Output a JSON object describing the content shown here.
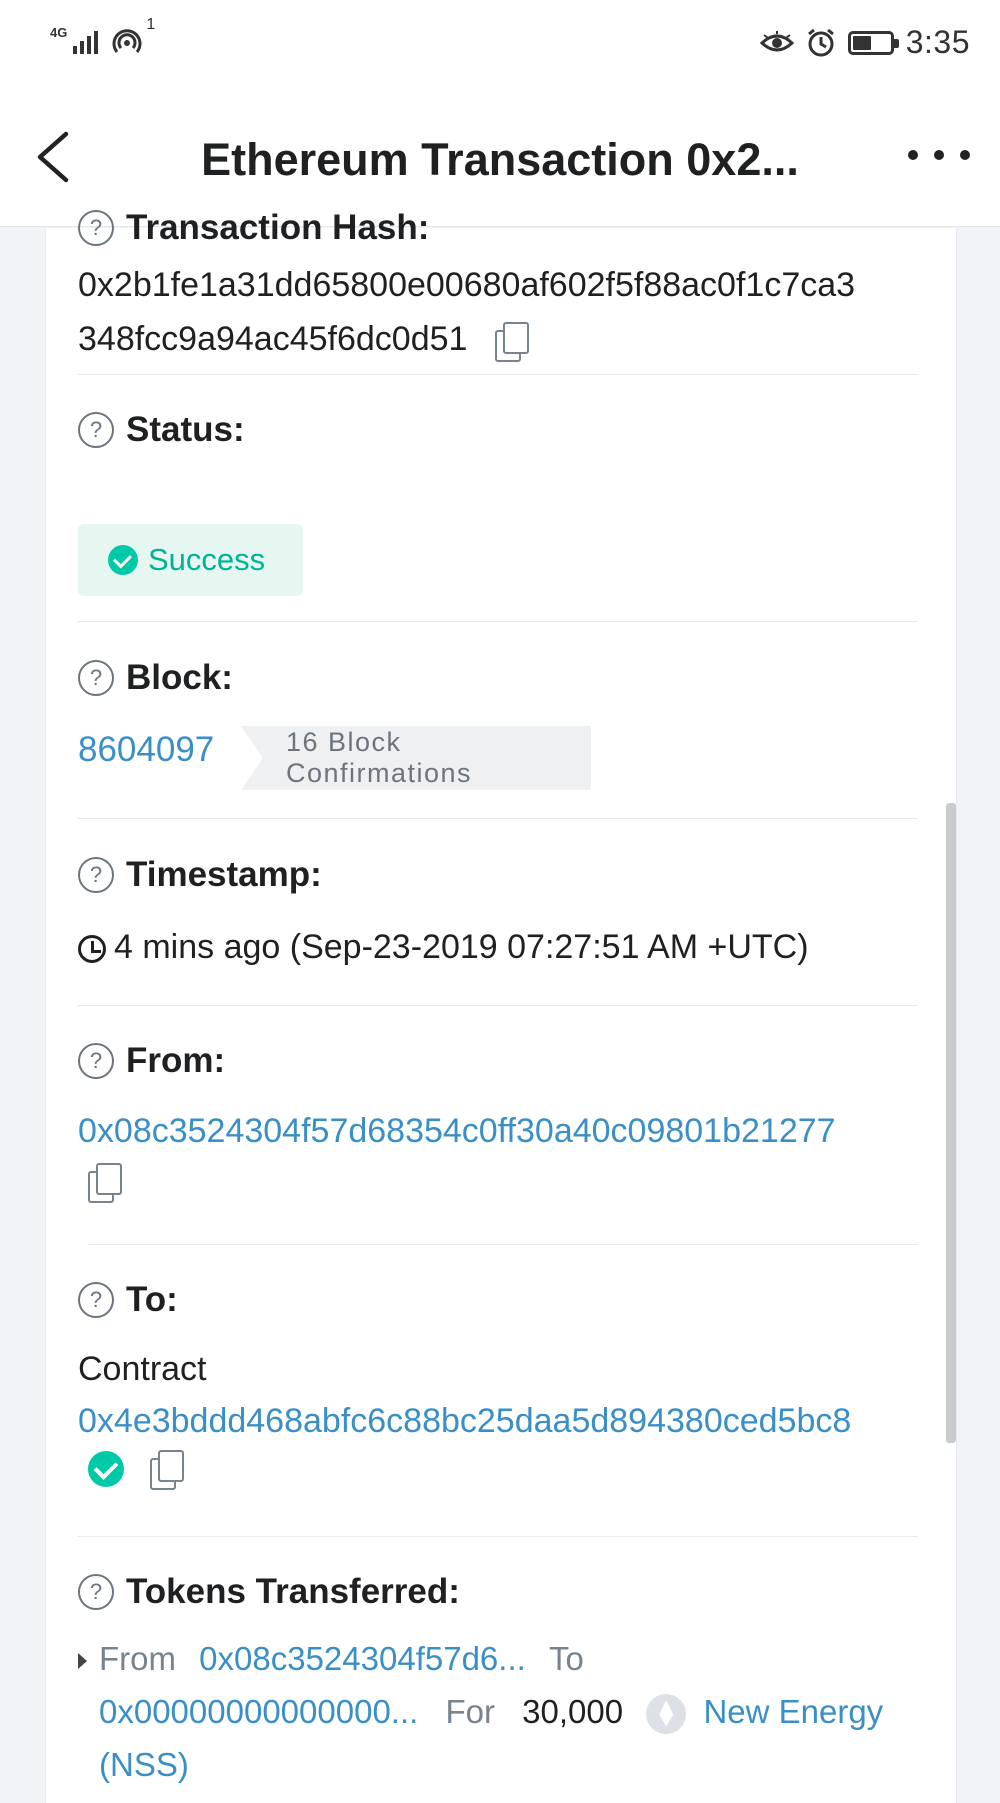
{
  "status_bar": {
    "network": "4G",
    "hotspot_count": "1",
    "time": "3:35"
  },
  "header": {
    "title": "Ethereum Transaction 0x2..."
  },
  "fields": {
    "tx_hash": {
      "label": "Transaction Hash:",
      "line1": "0x2b1fe1a31dd65800e00680af602f5f88ac0f1c7ca3",
      "line2": "348fcc9a94ac45f6dc0d51"
    },
    "status": {
      "label": "Status:",
      "value": "Success"
    },
    "block": {
      "label": "Block:",
      "number": "8604097",
      "confirmations": "16 Block Confirmations"
    },
    "timestamp": {
      "label": "Timestamp:",
      "value": "4 mins ago (Sep-23-2019 07:27:51 AM +UTC)"
    },
    "from": {
      "label": "From:",
      "address": "0x08c3524304f57d68354c0ff30a40c09801b21277"
    },
    "to": {
      "label": "To:",
      "type": "Contract",
      "address": "0x4e3bddd468abfc6c88bc25daa5d894380ced5bc8"
    },
    "tokens": {
      "label": "Tokens Transferred:",
      "from_label": "From",
      "from_address": "0x08c3524304f57d6...",
      "to_label": "To",
      "to_address": "0x00000000000000...",
      "for_label": "For",
      "amount": "30,000",
      "token_name": "New Energy",
      "token_symbol": "(NSS)"
    }
  }
}
